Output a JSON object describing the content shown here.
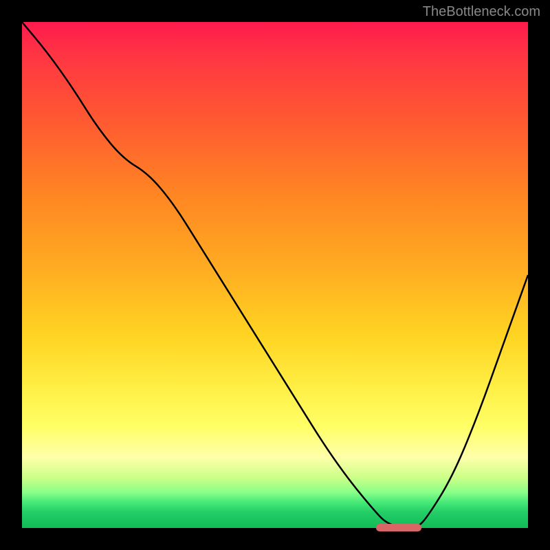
{
  "watermark": "TheBottleneck.com",
  "chart_data": {
    "type": "line",
    "title": "",
    "xlabel": "",
    "ylabel": "",
    "xlim": [
      0,
      100
    ],
    "ylim": [
      0,
      100
    ],
    "x": [
      0,
      5,
      10,
      15,
      20,
      25,
      30,
      35,
      40,
      45,
      50,
      55,
      60,
      65,
      70,
      72,
      75,
      78,
      80,
      85,
      90,
      95,
      100
    ],
    "y": [
      100,
      94,
      87,
      79,
      73,
      70,
      64,
      56,
      48,
      40,
      32,
      24,
      16,
      9,
      3,
      1,
      0,
      0,
      2,
      10,
      22,
      36,
      50
    ],
    "marker_range_x": [
      70,
      79
    ],
    "marker_y": 0,
    "gradient_meaning": "bottleneck severity (red=high, green=optimal)"
  }
}
